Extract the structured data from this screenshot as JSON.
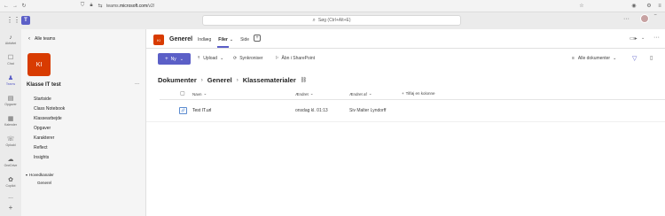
{
  "browser": {
    "url_prefix": "teams.",
    "url_domain": "microsoft.com",
    "url_suffix": "/v2/"
  },
  "search": {
    "placeholder": "Søg (Ctrl+Alt+E)"
  },
  "rail": {
    "items": [
      {
        "label": "Aktivitet",
        "icon": "bell-icon",
        "glyph": "♪"
      },
      {
        "label": "Chat",
        "icon": "chat-icon",
        "glyph": "☐"
      },
      {
        "label": "Teams",
        "icon": "teams-icon",
        "glyph": "♟"
      },
      {
        "label": "Opgaver",
        "icon": "assignments-icon",
        "glyph": "▤"
      },
      {
        "label": "Kalender",
        "icon": "calendar-icon",
        "glyph": "▦"
      },
      {
        "label": "Opkald",
        "icon": "phone-icon",
        "glyph": "☏"
      },
      {
        "label": "OneDrive",
        "icon": "cloud-icon",
        "glyph": "☁"
      },
      {
        "label": "Copilot",
        "icon": "copilot-icon",
        "glyph": "✿"
      }
    ],
    "more": "...",
    "add": "+"
  },
  "panel": {
    "back_label": "Alle teams",
    "team_initials": "KI",
    "team_color": "#d83b01",
    "team_name": "Klasse IT test",
    "team_more": "...",
    "nav": [
      "Startside",
      "Class Notebook",
      "Klassearbejde",
      "Opgaver",
      "Karakterer",
      "Reflect",
      "Insights"
    ],
    "channels_header": "Hovedkanaler",
    "channels": [
      "Generel"
    ]
  },
  "channel": {
    "badge": "KI",
    "name": "Generel",
    "tabs": [
      "Indlæg",
      "Filer",
      "Side"
    ],
    "active_tab": 1
  },
  "toolbar": {
    "new_label": "Ny",
    "upload_label": "Upload",
    "sync_label": "Synkroniser",
    "sharepoint_label": "Åbn i SharePoint",
    "docs_filter": "Alle dokumenter"
  },
  "breadcrumb": [
    "Dokumenter",
    "Generel",
    "Klassematerialer"
  ],
  "table": {
    "headers": [
      "Navn",
      "Ændret",
      "Ændret af",
      "Tilføj en kolonne"
    ],
    "rows": [
      {
        "name": "Test IT.url",
        "modified": "onsdag kl. 01:13",
        "modified_by": "Siv Malter Lyndorff"
      }
    ]
  },
  "colors": {
    "accent": "#5b5fc7",
    "brand": "#d83b01"
  }
}
